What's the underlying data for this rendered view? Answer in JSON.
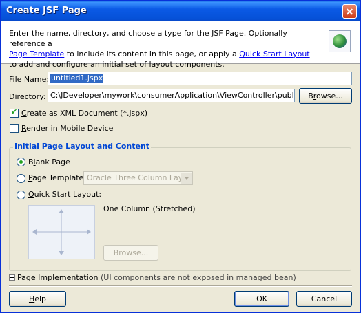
{
  "window": {
    "title": "Create JSF Page"
  },
  "header": {
    "intro_part1": "Enter the name, directory, and choose a type for the JSF Page. Optionally reference a",
    "page_template_link": "Page Template",
    "intro_part2": " to include its content in this page, or apply a ",
    "quick_start_link": "Quick Start Layout",
    "intro_part3": " to add and configure an initial set of layout components.",
    "icon": "globe-icon"
  },
  "form": {
    "file_name_label_ul": "F",
    "file_name_label_rest": "ile Name:",
    "file_name_value": "untitled1.jspx",
    "directory_label_ul": "D",
    "directory_label_rest": "irectory:",
    "directory_value": "C:\\JDeveloper\\mywork\\consumerApplication\\ViewController\\public_html",
    "browse_label_pre": "B",
    "browse_label_ul": "r",
    "browse_label_rest": "owse...",
    "create_xml_ul": "C",
    "create_xml_rest": "reate as XML Document (*.jspx)",
    "create_xml_checked": true,
    "render_mobile_ul": "R",
    "render_mobile_rest": "ender in Mobile Device",
    "render_mobile_checked": false
  },
  "layout_group": {
    "title": "Initial Page Layout and Content",
    "blank_page_pre": "B",
    "blank_page_ul": "l",
    "blank_page_rest": "ank Page",
    "page_template_ul": "P",
    "page_template_rest": "age Template:",
    "template_select_value": "Oracle Three Column Layout",
    "quick_start_ul": "Q",
    "quick_start_rest": "uick Start Layout:",
    "quick_start_selected_name": "One Column (Stretched)",
    "browse_disabled_label": "Browse...",
    "selected_option": "blank"
  },
  "implementation": {
    "label": "Page Implementation",
    "note": "(UI components are not exposed in managed bean)"
  },
  "footer": {
    "help_label": "Help",
    "help_ul": "H",
    "help_rest": "elp",
    "ok_label": "OK",
    "cancel_label": "Cancel"
  }
}
